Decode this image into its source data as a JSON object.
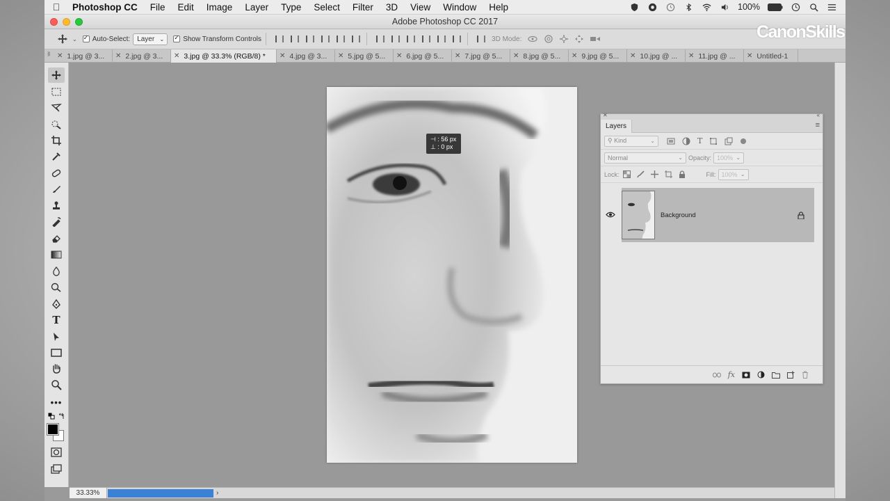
{
  "menubar": {
    "app": "Photoshop CC",
    "items": [
      "File",
      "Edit",
      "Image",
      "Layer",
      "Type",
      "Select",
      "Filter",
      "3D",
      "View",
      "Window",
      "Help"
    ],
    "battery": "100%"
  },
  "window": {
    "title": "Adobe Photoshop CC 2017"
  },
  "options": {
    "auto_select_label": "Auto-Select:",
    "auto_select_value": "Layer",
    "show_transform_label": "Show Transform Controls",
    "mode_label": "3D Mode:"
  },
  "tabs": [
    {
      "label": "1.jpg @ 3..."
    },
    {
      "label": "2.jpg @ 3..."
    },
    {
      "label": "3.jpg @ 33.3% (RGB/8) *"
    },
    {
      "label": "4.jpg @ 3..."
    },
    {
      "label": "5.jpg @ 5..."
    },
    {
      "label": "6.jpg @ 5..."
    },
    {
      "label": "7.jpg @ 5..."
    },
    {
      "label": "8.jpg @ 5..."
    },
    {
      "label": "9.jpg @ 5..."
    },
    {
      "label": "10.jpg @ ..."
    },
    {
      "label": "11.jpg @ ..."
    },
    {
      "label": "Untitled-1"
    }
  ],
  "measure": {
    "x": "56 px",
    "y": "0 px"
  },
  "layers_panel": {
    "tab": "Layers",
    "kind_placeholder": "Kind",
    "blend_mode": "Normal",
    "opacity_label": "Opacity:",
    "opacity_value": "100%",
    "lock_label": "Lock:",
    "fill_label": "Fill:",
    "fill_value": "100%",
    "layer_name": "Background"
  },
  "status": {
    "zoom": "33.33%"
  },
  "watermark": "CanonSkills"
}
